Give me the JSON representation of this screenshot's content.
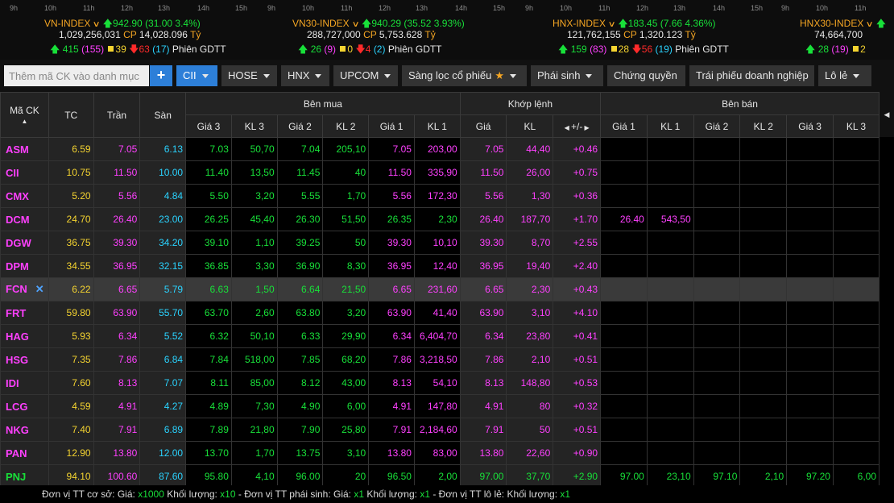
{
  "indices": [
    {
      "axis": [
        "9h",
        "10h",
        "11h",
        "12h",
        "13h",
        "14h",
        "15h"
      ],
      "name": "VN-INDEX",
      "value": "942.90",
      "change": "(31.00 3.4%)",
      "volume": "1,029,256,031",
      "cp_label": "CP",
      "value_traded": "14,028.096",
      "unit": "Tỷ",
      "adv": "415",
      "adv_ceil": "(155)",
      "unch": "39",
      "dec": "63",
      "dec_floor": "(17)",
      "session": "Phiên GDTT"
    },
    {
      "axis": [
        "9h",
        "10h",
        "11h",
        "12h",
        "13h",
        "14h",
        "15h"
      ],
      "name": "VN30-INDEX",
      "value": "940.29",
      "change": "(35.52 3.93%)",
      "volume": "288,727,000",
      "cp_label": "CP",
      "value_traded": "5,753.628",
      "unit": "Tỷ",
      "adv": "26",
      "adv_ceil": "(9)",
      "unch": "0",
      "dec": "4",
      "dec_floor": "(2)",
      "session": "Phiên GDTT"
    },
    {
      "axis": [
        "9h",
        "10h",
        "11h",
        "12h",
        "13h",
        "14h",
        "15h"
      ],
      "name": "HNX-INDEX",
      "value": "183.45",
      "change": "(7.66 4.36%)",
      "volume": "121,762,155",
      "cp_label": "CP",
      "value_traded": "1,320.123",
      "unit": "Tỷ",
      "adv": "159",
      "adv_ceil": "(83)",
      "unch": "28",
      "dec": "56",
      "dec_floor": "(19)",
      "session": "Phiên GDTT"
    },
    {
      "axis": [
        "9h",
        "10h",
        "11h"
      ],
      "name": "HNX30-INDEX",
      "value": "",
      "change": "",
      "volume": "74,664,700",
      "cp_label": "",
      "value_traded": "",
      "unit": "",
      "adv": "28",
      "adv_ceil": "(19)",
      "unch": "2",
      "dec": "",
      "dec_floor": "",
      "session": ""
    }
  ],
  "toolbar": {
    "search_placeholder": "Thêm mã CK vào danh mục",
    "add_label": "+",
    "buttons": [
      {
        "label": "CII",
        "active": true,
        "caret": true,
        "star": false
      },
      {
        "label": "HOSE",
        "active": false,
        "caret": true,
        "star": false
      },
      {
        "label": "HNX",
        "active": false,
        "caret": true,
        "star": false
      },
      {
        "label": "UPCOM",
        "active": false,
        "caret": true,
        "star": false
      },
      {
        "label": "Sàng lọc cổ phiếu",
        "active": false,
        "caret": true,
        "star": true
      },
      {
        "label": "Phái sinh",
        "active": false,
        "caret": true,
        "star": false
      },
      {
        "label": "Chứng quyền",
        "active": false,
        "caret": false,
        "star": false
      },
      {
        "label": "Trái phiếu doanh nghiệp",
        "active": false,
        "caret": false,
        "star": false
      },
      {
        "label": "Lô lẻ",
        "active": false,
        "caret": true,
        "star": false
      }
    ]
  },
  "table": {
    "headers": {
      "symbol": "Mã CK",
      "ref": "TC",
      "ceil": "Trần",
      "floor": "Sàn",
      "buy": "Bên mua",
      "match": "Khớp lệnh",
      "sell": "Bên bán",
      "buy_cols": [
        "Giá 3",
        "KL 3",
        "Giá 2",
        "KL 2",
        "Giá 1",
        "KL 1"
      ],
      "match_cols": [
        "Giá",
        "KL",
        "+/-"
      ],
      "sell_cols": [
        "Giá 1",
        "KL 1",
        "Giá 2",
        "KL 2",
        "Giá 3",
        "KL 3"
      ]
    },
    "rows": [
      {
        "sym": "ASM",
        "tc": "6.59",
        "tran": "7.05",
        "san": "6.13",
        "b3": "7.03",
        "bk3": "50,70",
        "b2": "7.04",
        "bk2": "205,10",
        "b1": "7.05",
        "bk1": "203,00",
        "p": "7.05",
        "kl": "44,40",
        "chg": "+0.46",
        "s1": "",
        "sk1": "",
        "s2": "",
        "sk2": "",
        "s3": "",
        "sk3": ""
      },
      {
        "sym": "CII",
        "tc": "10.75",
        "tran": "11.50",
        "san": "10.00",
        "b3": "11.40",
        "bk3": "13,50",
        "b2": "11.45",
        "bk2": "40",
        "b1": "11.50",
        "bk1": "335,90",
        "p": "11.50",
        "kl": "26,00",
        "chg": "+0.75",
        "s1": "",
        "sk1": "",
        "s2": "",
        "sk2": "",
        "s3": "",
        "sk3": ""
      },
      {
        "sym": "CMX",
        "tc": "5.20",
        "tran": "5.56",
        "san": "4.84",
        "b3": "5.50",
        "bk3": "3,20",
        "b2": "5.55",
        "bk2": "1,70",
        "b1": "5.56",
        "bk1": "172,30",
        "p": "5.56",
        "kl": "1,30",
        "chg": "+0.36",
        "s1": "",
        "sk1": "",
        "s2": "",
        "sk2": "",
        "s3": "",
        "sk3": ""
      },
      {
        "sym": "DCM",
        "tc": "24.70",
        "tran": "26.40",
        "san": "23.00",
        "b3": "26.25",
        "bk3": "45,40",
        "b2": "26.30",
        "bk2": "51,50",
        "b1": "26.35",
        "bk1": "2,30",
        "p": "26.40",
        "kl": "187,70",
        "chg": "+1.70",
        "s1": "26.40",
        "sk1": "543,50",
        "s2": "",
        "sk2": "",
        "s3": "",
        "sk3": ""
      },
      {
        "sym": "DGW",
        "tc": "36.75",
        "tran": "39.30",
        "san": "34.20",
        "b3": "39.10",
        "bk3": "1,10",
        "b2": "39.25",
        "bk2": "50",
        "b1": "39.30",
        "bk1": "10,10",
        "p": "39.30",
        "kl": "8,70",
        "chg": "+2.55",
        "s1": "",
        "sk1": "",
        "s2": "",
        "sk2": "",
        "s3": "",
        "sk3": ""
      },
      {
        "sym": "DPM",
        "tc": "34.55",
        "tran": "36.95",
        "san": "32.15",
        "b3": "36.85",
        "bk3": "3,30",
        "b2": "36.90",
        "bk2": "8,30",
        "b1": "36.95",
        "bk1": "12,40",
        "p": "36.95",
        "kl": "19,40",
        "chg": "+2.40",
        "s1": "",
        "sk1": "",
        "s2": "",
        "sk2": "",
        "s3": "",
        "sk3": ""
      },
      {
        "sym": "FCN",
        "tc": "6.22",
        "tran": "6.65",
        "san": "5.79",
        "b3": "6.63",
        "bk3": "1,50",
        "b2": "6.64",
        "bk2": "21,50",
        "b1": "6.65",
        "bk1": "231,60",
        "p": "6.65",
        "kl": "2,30",
        "chg": "+0.43",
        "s1": "",
        "sk1": "",
        "s2": "",
        "sk2": "",
        "s3": "",
        "sk3": ""
      },
      {
        "sym": "FRT",
        "tc": "59.80",
        "tran": "63.90",
        "san": "55.70",
        "b3": "63.70",
        "bk3": "2,60",
        "b2": "63.80",
        "bk2": "3,20",
        "b1": "63.90",
        "bk1": "41,40",
        "p": "63.90",
        "kl": "3,10",
        "chg": "+4.10",
        "s1": "",
        "sk1": "",
        "s2": "",
        "sk2": "",
        "s3": "",
        "sk3": ""
      },
      {
        "sym": "HAG",
        "tc": "5.93",
        "tran": "6.34",
        "san": "5.52",
        "b3": "6.32",
        "bk3": "50,10",
        "b2": "6.33",
        "bk2": "29,90",
        "b1": "6.34",
        "bk1": "6,404,70",
        "p": "6.34",
        "kl": "23,80",
        "chg": "+0.41",
        "s1": "",
        "sk1": "",
        "s2": "",
        "sk2": "",
        "s3": "",
        "sk3": ""
      },
      {
        "sym": "HSG",
        "tc": "7.35",
        "tran": "7.86",
        "san": "6.84",
        "b3": "7.84",
        "bk3": "518,00",
        "b2": "7.85",
        "bk2": "68,20",
        "b1": "7.86",
        "bk1": "3,218,50",
        "p": "7.86",
        "kl": "2,10",
        "chg": "+0.51",
        "s1": "",
        "sk1": "",
        "s2": "",
        "sk2": "",
        "s3": "",
        "sk3": ""
      },
      {
        "sym": "IDI",
        "tc": "7.60",
        "tran": "8.13",
        "san": "7.07",
        "b3": "8.11",
        "bk3": "85,00",
        "b2": "8.12",
        "bk2": "43,00",
        "b1": "8.13",
        "bk1": "54,10",
        "p": "8.13",
        "kl": "148,80",
        "chg": "+0.53",
        "s1": "",
        "sk1": "",
        "s2": "",
        "sk2": "",
        "s3": "",
        "sk3": ""
      },
      {
        "sym": "LCG",
        "tc": "4.59",
        "tran": "4.91",
        "san": "4.27",
        "b3": "4.89",
        "bk3": "7,30",
        "b2": "4.90",
        "bk2": "6,00",
        "b1": "4.91",
        "bk1": "147,80",
        "p": "4.91",
        "kl": "80",
        "chg": "+0.32",
        "s1": "",
        "sk1": "",
        "s2": "",
        "sk2": "",
        "s3": "",
        "sk3": ""
      },
      {
        "sym": "NKG",
        "tc": "7.40",
        "tran": "7.91",
        "san": "6.89",
        "b3": "7.89",
        "bk3": "21,80",
        "b2": "7.90",
        "bk2": "25,80",
        "b1": "7.91",
        "bk1": "2,184,60",
        "p": "7.91",
        "kl": "50",
        "chg": "+0.51",
        "s1": "",
        "sk1": "",
        "s2": "",
        "sk2": "",
        "s3": "",
        "sk3": ""
      },
      {
        "sym": "PAN",
        "tc": "12.90",
        "tran": "13.80",
        "san": "12.00",
        "b3": "13.70",
        "bk3": "1,70",
        "b2": "13.75",
        "bk2": "3,10",
        "b1": "13.80",
        "bk1": "83,00",
        "p": "13.80",
        "kl": "22,60",
        "chg": "+0.90",
        "s1": "",
        "sk1": "",
        "s2": "",
        "sk2": "",
        "s3": "",
        "sk3": ""
      },
      {
        "sym": "PNJ",
        "tc": "94.10",
        "tran": "100.60",
        "san": "87.60",
        "b3": "95.80",
        "bk3": "4,10",
        "b2": "96.00",
        "bk2": "20",
        "b1": "96.50",
        "bk1": "2,00",
        "p": "97.00",
        "kl": "37,70",
        "chg": "+2.90",
        "s1": "97.00",
        "sk1": "23,10",
        "s2": "97.10",
        "sk2": "2,10",
        "s3": "97.20",
        "sk3": "6,00"
      }
    ],
    "highlight_row": "FCN"
  },
  "footer": {
    "t1": "Đơn vị TT cơ sở: Giá: ",
    "v1": "x1000",
    "t2": " Khối lượng: ",
    "v2": "x10",
    "t3": " - Đơn vị TT phái sinh: Giá: ",
    "v3": "x1",
    "t4": " Khối lượng: ",
    "v4": "x1",
    "t5": " - Đơn vị TT lô lẻ: Khối lượng: ",
    "v5": "x1"
  }
}
